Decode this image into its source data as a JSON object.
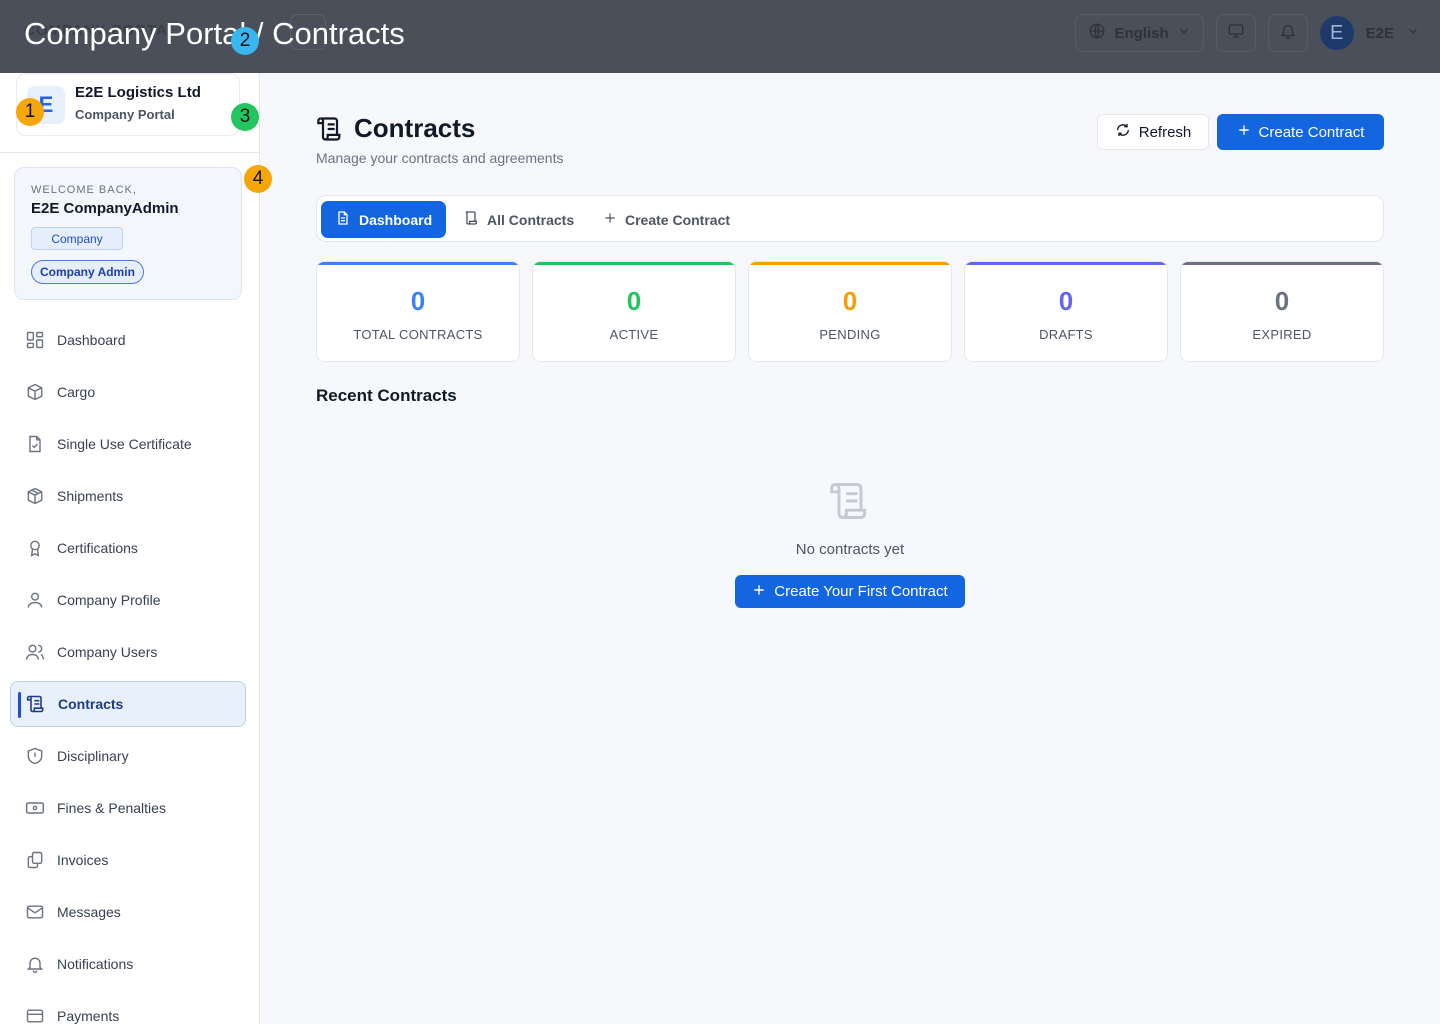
{
  "header": {
    "ghost_text": "COMPANY PORTAL",
    "overlay_title": "Company Portal / Contracts",
    "language": "English",
    "avatar_letter": "E",
    "user_short": "E2E"
  },
  "sidebar": {
    "brand_logo": "E",
    "brand_name": "E2E Logistics Ltd",
    "brand_sub": "Company Portal",
    "welcome_label": "WELCOME BACK,",
    "welcome_name": "E2E CompanyAdmin",
    "role_tag": "Company",
    "role_badge": "Company Admin",
    "items": [
      {
        "label": "Dashboard",
        "icon": "grid-icon"
      },
      {
        "label": "Cargo",
        "icon": "package-icon"
      },
      {
        "label": "Single Use Certificate",
        "icon": "file-check-icon"
      },
      {
        "label": "Shipments",
        "icon": "box-icon"
      },
      {
        "label": "Certifications",
        "icon": "award-icon"
      },
      {
        "label": "Company Profile",
        "icon": "user-icon"
      },
      {
        "label": "Company Users",
        "icon": "users-icon"
      },
      {
        "label": "Contracts",
        "icon": "scroll-icon",
        "active": true
      },
      {
        "label": "Disciplinary",
        "icon": "shield-icon"
      },
      {
        "label": "Fines & Penalties",
        "icon": "banknote-icon"
      },
      {
        "label": "Invoices",
        "icon": "copy-icon"
      },
      {
        "label": "Messages",
        "icon": "mail-icon"
      },
      {
        "label": "Notifications",
        "icon": "bell-icon"
      },
      {
        "label": "Payments",
        "icon": "card-icon"
      }
    ]
  },
  "main": {
    "title": "Contracts",
    "subtitle": "Manage your contracts and agreements",
    "refresh_label": "Refresh",
    "create_label": "Create Contract",
    "tabs": [
      {
        "label": "Dashboard",
        "active": true
      },
      {
        "label": "All Contracts"
      },
      {
        "label": "Create Contract"
      }
    ],
    "stats": [
      {
        "value": "0",
        "label": "TOTAL CONTRACTS",
        "color": "#3b82f6"
      },
      {
        "value": "0",
        "label": "ACTIVE",
        "color": "#22c55e"
      },
      {
        "value": "0",
        "label": "PENDING",
        "color": "#f59e0b"
      },
      {
        "value": "0",
        "label": "DRAFTS",
        "color": "#6366f1"
      },
      {
        "value": "0",
        "label": "EXPIRED",
        "color": "#6b7280"
      }
    ],
    "recent_title": "Recent Contracts",
    "empty_text": "No contracts yet",
    "empty_cta": "Create Your First Contract"
  },
  "markers": [
    {
      "n": "1",
      "color": "#f5a70a"
    },
    {
      "n": "2",
      "color": "#38b6f0"
    },
    {
      "n": "3",
      "color": "#22c55e"
    },
    {
      "n": "4",
      "color": "#f5a70a"
    }
  ]
}
